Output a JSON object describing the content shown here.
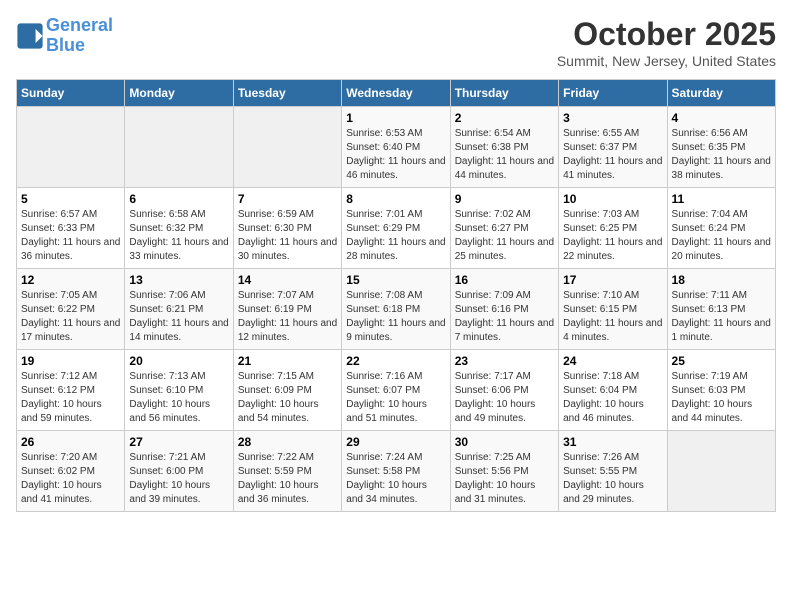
{
  "header": {
    "logo_line1": "General",
    "logo_line2": "Blue",
    "month": "October 2025",
    "location": "Summit, New Jersey, United States"
  },
  "weekdays": [
    "Sunday",
    "Monday",
    "Tuesday",
    "Wednesday",
    "Thursday",
    "Friday",
    "Saturday"
  ],
  "weeks": [
    [
      {
        "day": "",
        "sunrise": "",
        "sunset": "",
        "daylight": ""
      },
      {
        "day": "",
        "sunrise": "",
        "sunset": "",
        "daylight": ""
      },
      {
        "day": "",
        "sunrise": "",
        "sunset": "",
        "daylight": ""
      },
      {
        "day": "1",
        "sunrise": "Sunrise: 6:53 AM",
        "sunset": "Sunset: 6:40 PM",
        "daylight": "Daylight: 11 hours and 46 minutes."
      },
      {
        "day": "2",
        "sunrise": "Sunrise: 6:54 AM",
        "sunset": "Sunset: 6:38 PM",
        "daylight": "Daylight: 11 hours and 44 minutes."
      },
      {
        "day": "3",
        "sunrise": "Sunrise: 6:55 AM",
        "sunset": "Sunset: 6:37 PM",
        "daylight": "Daylight: 11 hours and 41 minutes."
      },
      {
        "day": "4",
        "sunrise": "Sunrise: 6:56 AM",
        "sunset": "Sunset: 6:35 PM",
        "daylight": "Daylight: 11 hours and 38 minutes."
      }
    ],
    [
      {
        "day": "5",
        "sunrise": "Sunrise: 6:57 AM",
        "sunset": "Sunset: 6:33 PM",
        "daylight": "Daylight: 11 hours and 36 minutes."
      },
      {
        "day": "6",
        "sunrise": "Sunrise: 6:58 AM",
        "sunset": "Sunset: 6:32 PM",
        "daylight": "Daylight: 11 hours and 33 minutes."
      },
      {
        "day": "7",
        "sunrise": "Sunrise: 6:59 AM",
        "sunset": "Sunset: 6:30 PM",
        "daylight": "Daylight: 11 hours and 30 minutes."
      },
      {
        "day": "8",
        "sunrise": "Sunrise: 7:01 AM",
        "sunset": "Sunset: 6:29 PM",
        "daylight": "Daylight: 11 hours and 28 minutes."
      },
      {
        "day": "9",
        "sunrise": "Sunrise: 7:02 AM",
        "sunset": "Sunset: 6:27 PM",
        "daylight": "Daylight: 11 hours and 25 minutes."
      },
      {
        "day": "10",
        "sunrise": "Sunrise: 7:03 AM",
        "sunset": "Sunset: 6:25 PM",
        "daylight": "Daylight: 11 hours and 22 minutes."
      },
      {
        "day": "11",
        "sunrise": "Sunrise: 7:04 AM",
        "sunset": "Sunset: 6:24 PM",
        "daylight": "Daylight: 11 hours and 20 minutes."
      }
    ],
    [
      {
        "day": "12",
        "sunrise": "Sunrise: 7:05 AM",
        "sunset": "Sunset: 6:22 PM",
        "daylight": "Daylight: 11 hours and 17 minutes."
      },
      {
        "day": "13",
        "sunrise": "Sunrise: 7:06 AM",
        "sunset": "Sunset: 6:21 PM",
        "daylight": "Daylight: 11 hours and 14 minutes."
      },
      {
        "day": "14",
        "sunrise": "Sunrise: 7:07 AM",
        "sunset": "Sunset: 6:19 PM",
        "daylight": "Daylight: 11 hours and 12 minutes."
      },
      {
        "day": "15",
        "sunrise": "Sunrise: 7:08 AM",
        "sunset": "Sunset: 6:18 PM",
        "daylight": "Daylight: 11 hours and 9 minutes."
      },
      {
        "day": "16",
        "sunrise": "Sunrise: 7:09 AM",
        "sunset": "Sunset: 6:16 PM",
        "daylight": "Daylight: 11 hours and 7 minutes."
      },
      {
        "day": "17",
        "sunrise": "Sunrise: 7:10 AM",
        "sunset": "Sunset: 6:15 PM",
        "daylight": "Daylight: 11 hours and 4 minutes."
      },
      {
        "day": "18",
        "sunrise": "Sunrise: 7:11 AM",
        "sunset": "Sunset: 6:13 PM",
        "daylight": "Daylight: 11 hours and 1 minute."
      }
    ],
    [
      {
        "day": "19",
        "sunrise": "Sunrise: 7:12 AM",
        "sunset": "Sunset: 6:12 PM",
        "daylight": "Daylight: 10 hours and 59 minutes."
      },
      {
        "day": "20",
        "sunrise": "Sunrise: 7:13 AM",
        "sunset": "Sunset: 6:10 PM",
        "daylight": "Daylight: 10 hours and 56 minutes."
      },
      {
        "day": "21",
        "sunrise": "Sunrise: 7:15 AM",
        "sunset": "Sunset: 6:09 PM",
        "daylight": "Daylight: 10 hours and 54 minutes."
      },
      {
        "day": "22",
        "sunrise": "Sunrise: 7:16 AM",
        "sunset": "Sunset: 6:07 PM",
        "daylight": "Daylight: 10 hours and 51 minutes."
      },
      {
        "day": "23",
        "sunrise": "Sunrise: 7:17 AM",
        "sunset": "Sunset: 6:06 PM",
        "daylight": "Daylight: 10 hours and 49 minutes."
      },
      {
        "day": "24",
        "sunrise": "Sunrise: 7:18 AM",
        "sunset": "Sunset: 6:04 PM",
        "daylight": "Daylight: 10 hours and 46 minutes."
      },
      {
        "day": "25",
        "sunrise": "Sunrise: 7:19 AM",
        "sunset": "Sunset: 6:03 PM",
        "daylight": "Daylight: 10 hours and 44 minutes."
      }
    ],
    [
      {
        "day": "26",
        "sunrise": "Sunrise: 7:20 AM",
        "sunset": "Sunset: 6:02 PM",
        "daylight": "Daylight: 10 hours and 41 minutes."
      },
      {
        "day": "27",
        "sunrise": "Sunrise: 7:21 AM",
        "sunset": "Sunset: 6:00 PM",
        "daylight": "Daylight: 10 hours and 39 minutes."
      },
      {
        "day": "28",
        "sunrise": "Sunrise: 7:22 AM",
        "sunset": "Sunset: 5:59 PM",
        "daylight": "Daylight: 10 hours and 36 minutes."
      },
      {
        "day": "29",
        "sunrise": "Sunrise: 7:24 AM",
        "sunset": "Sunset: 5:58 PM",
        "daylight": "Daylight: 10 hours and 34 minutes."
      },
      {
        "day": "30",
        "sunrise": "Sunrise: 7:25 AM",
        "sunset": "Sunset: 5:56 PM",
        "daylight": "Daylight: 10 hours and 31 minutes."
      },
      {
        "day": "31",
        "sunrise": "Sunrise: 7:26 AM",
        "sunset": "Sunset: 5:55 PM",
        "daylight": "Daylight: 10 hours and 29 minutes."
      },
      {
        "day": "",
        "sunrise": "",
        "sunset": "",
        "daylight": ""
      }
    ]
  ]
}
